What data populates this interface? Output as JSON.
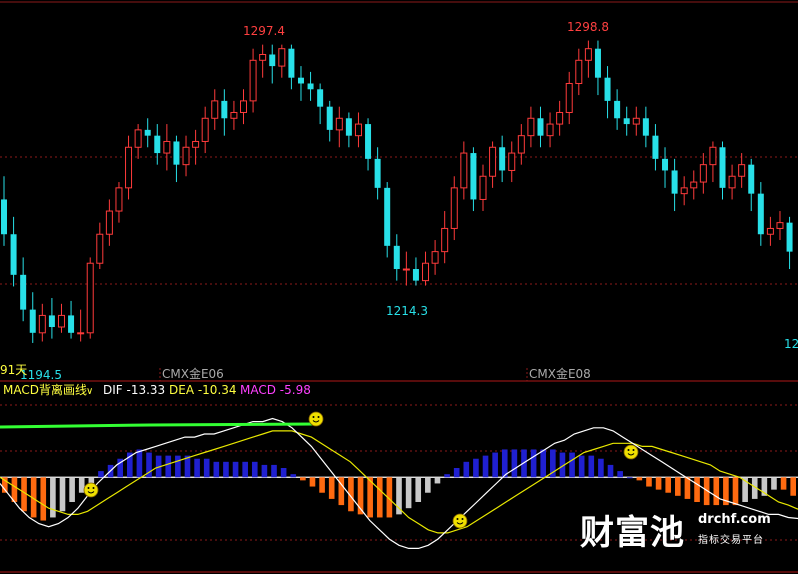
{
  "chart_data": [
    {
      "type": "candlestick",
      "peak_labels": [
        "1297.4",
        "1298.8"
      ],
      "trough_labels": [
        "1194.5",
        "1214.3"
      ],
      "left_edge_label": "91天",
      "right_edge_label": "12",
      "contract_labels": [
        "CMX金E06",
        "CMX金E08"
      ],
      "colors": {
        "up": "#ff3b3b",
        "down": "#28e0e8",
        "peak_label": "#ff4040",
        "trough_label": "#28e0e8",
        "grid": "#8b1a1a"
      },
      "candles": [
        [
          1244,
          1232,
          1252,
          1228
        ],
        [
          1232,
          1218,
          1238,
          1214
        ],
        [
          1218,
          1206,
          1224,
          1202
        ],
        [
          1206,
          1198,
          1212,
          1194.5
        ],
        [
          1198,
          1204,
          1208,
          1195
        ],
        [
          1204,
          1200,
          1210,
          1196
        ],
        [
          1200,
          1204,
          1208,
          1198
        ],
        [
          1204,
          1198,
          1209,
          1196
        ],
        [
          1198,
          1198,
          1206,
          1195
        ],
        [
          1198,
          1222,
          1224,
          1196
        ],
        [
          1222,
          1232,
          1236,
          1220
        ],
        [
          1232,
          1240,
          1244,
          1228
        ],
        [
          1240,
          1248,
          1250,
          1236
        ],
        [
          1248,
          1262,
          1266,
          1244
        ],
        [
          1262,
          1268,
          1270,
          1258
        ],
        [
          1268,
          1266,
          1272,
          1262
        ],
        [
          1266,
          1260,
          1270,
          1256
        ],
        [
          1260,
          1264,
          1270,
          1254
        ],
        [
          1264,
          1256,
          1266,
          1250
        ],
        [
          1256,
          1262,
          1266,
          1252
        ],
        [
          1262,
          1264,
          1268,
          1256
        ],
        [
          1264,
          1272,
          1276,
          1260
        ],
        [
          1272,
          1278,
          1282,
          1268
        ],
        [
          1278,
          1272,
          1282,
          1266
        ],
        [
          1272,
          1274,
          1278,
          1268
        ],
        [
          1274,
          1278,
          1282,
          1270
        ],
        [
          1278,
          1292,
          1296,
          1274
        ],
        [
          1292,
          1294,
          1297.4,
          1286
        ],
        [
          1294,
          1290,
          1297.4,
          1284
        ],
        [
          1290,
          1296,
          1297.4,
          1286
        ],
        [
          1296,
          1286,
          1297.4,
          1282
        ],
        [
          1286,
          1284,
          1290,
          1278
        ],
        [
          1284,
          1282,
          1288,
          1278
        ],
        [
          1282,
          1276,
          1284,
          1270
        ],
        [
          1276,
          1268,
          1278,
          1264
        ],
        [
          1268,
          1272,
          1276,
          1262
        ],
        [
          1272,
          1266,
          1274,
          1262
        ],
        [
          1266,
          1270,
          1274,
          1262
        ],
        [
          1270,
          1258,
          1272,
          1254
        ],
        [
          1258,
          1248,
          1262,
          1244
        ],
        [
          1248,
          1228,
          1250,
          1224
        ],
        [
          1228,
          1220,
          1232,
          1216
        ],
        [
          1220,
          1220,
          1226,
          1214.3
        ],
        [
          1220,
          1216,
          1224,
          1214.3
        ],
        [
          1216,
          1222,
          1226,
          1214.3
        ],
        [
          1222,
          1226,
          1230,
          1218
        ],
        [
          1226,
          1234,
          1240,
          1222
        ],
        [
          1234,
          1248,
          1252,
          1230
        ],
        [
          1248,
          1260,
          1264,
          1244
        ],
        [
          1260,
          1244,
          1262,
          1240
        ],
        [
          1244,
          1252,
          1256,
          1240
        ],
        [
          1252,
          1262,
          1264,
          1248
        ],
        [
          1262,
          1254,
          1266,
          1250
        ],
        [
          1254,
          1260,
          1264,
          1250
        ],
        [
          1260,
          1266,
          1270,
          1256
        ],
        [
          1266,
          1272,
          1276,
          1262
        ],
        [
          1272,
          1266,
          1276,
          1262
        ],
        [
          1266,
          1270,
          1274,
          1262
        ],
        [
          1270,
          1274,
          1278,
          1266
        ],
        [
          1274,
          1284,
          1288,
          1270
        ],
        [
          1284,
          1292,
          1296,
          1280
        ],
        [
          1292,
          1296,
          1298.8,
          1286
        ],
        [
          1296,
          1286,
          1298.8,
          1280
        ],
        [
          1286,
          1278,
          1290,
          1272
        ],
        [
          1278,
          1272,
          1282,
          1268
        ],
        [
          1272,
          1270,
          1276,
          1266
        ],
        [
          1270,
          1272,
          1276,
          1266
        ],
        [
          1272,
          1266,
          1276,
          1262
        ],
        [
          1266,
          1258,
          1270,
          1254
        ],
        [
          1258,
          1254,
          1262,
          1248
        ],
        [
          1254,
          1246,
          1258,
          1240
        ],
        [
          1246,
          1248,
          1252,
          1242
        ],
        [
          1248,
          1250,
          1254,
          1244
        ],
        [
          1250,
          1256,
          1260,
          1246
        ],
        [
          1256,
          1262,
          1264,
          1250
        ],
        [
          1262,
          1248,
          1264,
          1244
        ],
        [
          1248,
          1252,
          1256,
          1244
        ],
        [
          1252,
          1256,
          1260,
          1248
        ],
        [
          1256,
          1246,
          1258,
          1240
        ],
        [
          1246,
          1232,
          1250,
          1228
        ],
        [
          1232,
          1234,
          1238,
          1228
        ],
        [
          1234,
          1236,
          1240,
          1230
        ],
        [
          1236,
          1226,
          1238,
          1220
        ]
      ]
    },
    {
      "type": "macd",
      "indicator_name": "MACD背离画线",
      "dif_label": "DIF -13.33",
      "dea_label": "DEA -10.34",
      "macd_label": "MACD -5.98",
      "colors": {
        "dif": "#ffffff",
        "dea": "#e8e800",
        "hist_pos": "#2020d0",
        "hist_neg": "#ff6a10",
        "hist_fade": "#c8c8c8",
        "divergence_line": "#33ff33",
        "label": "#ffff40",
        "macd_label": "#ff40ff"
      },
      "dif": [
        -2,
        -6,
        -10,
        -13,
        -15,
        -16,
        -15,
        -13,
        -10,
        -6,
        -2,
        1,
        4,
        6,
        8,
        9,
        10,
        11,
        12,
        13,
        13,
        14,
        14,
        15,
        16,
        17,
        18,
        18,
        19,
        18,
        16,
        13,
        10,
        6,
        2,
        -2,
        -6,
        -10,
        -14,
        -17,
        -20,
        -22,
        -23,
        -23,
        -22,
        -20,
        -17,
        -14,
        -11,
        -8,
        -5,
        -2,
        1,
        3,
        5,
        7,
        9,
        11,
        12,
        14,
        15,
        16,
        16,
        15,
        13,
        11,
        9,
        7,
        5,
        3,
        1,
        -1,
        -3,
        -5,
        -7,
        -8,
        -9,
        -10,
        -11,
        -12,
        -12,
        -13,
        -13.33
      ],
      "dea": [
        0,
        -2,
        -4,
        -6,
        -8,
        -10,
        -11,
        -12,
        -12,
        -11,
        -9,
        -7,
        -5,
        -3,
        -1,
        1,
        3,
        4,
        5,
        6,
        7,
        8,
        9,
        10,
        11,
        12,
        13,
        14,
        15,
        15,
        15,
        14,
        13,
        11,
        9,
        7,
        5,
        2,
        -1,
        -4,
        -7,
        -10,
        -13,
        -15,
        -17,
        -18,
        -18,
        -17,
        -16,
        -14,
        -12,
        -10,
        -8,
        -6,
        -4,
        -2,
        0,
        2,
        4,
        6,
        8,
        9,
        10,
        11,
        11,
        11,
        10,
        10,
        9,
        8,
        7,
        6,
        5,
        4,
        2,
        1,
        0,
        -2,
        -4,
        -6,
        -8,
        -9,
        -10.34
      ],
      "hist": [
        -5,
        -8,
        -11,
        -13,
        -14,
        -13,
        -11,
        -8,
        -5,
        -2,
        2,
        4,
        6,
        8,
        9,
        8,
        7,
        7,
        7,
        7,
        6,
        6,
        5,
        5,
        5,
        5,
        5,
        4,
        4,
        3,
        1,
        -1,
        -3,
        -5,
        -7,
        -9,
        -11,
        -12,
        -13,
        -13,
        -13,
        -12,
        -10,
        -8,
        -5,
        -2,
        1,
        3,
        5,
        6,
        7,
        8,
        9,
        9,
        9,
        9,
        9,
        9,
        8,
        8,
        7,
        7,
        6,
        4,
        2,
        0,
        -1,
        -3,
        -4,
        -5,
        -6,
        -7,
        -8,
        -9,
        -9,
        -9,
        -9,
        -8,
        -7,
        -6,
        -4,
        -4,
        -5.98
      ],
      "ylim": [
        -30,
        25
      ]
    }
  ],
  "watermark": {
    "brand": "财富池",
    "site": "drchf.com",
    "tagline": "指标交易平台"
  }
}
